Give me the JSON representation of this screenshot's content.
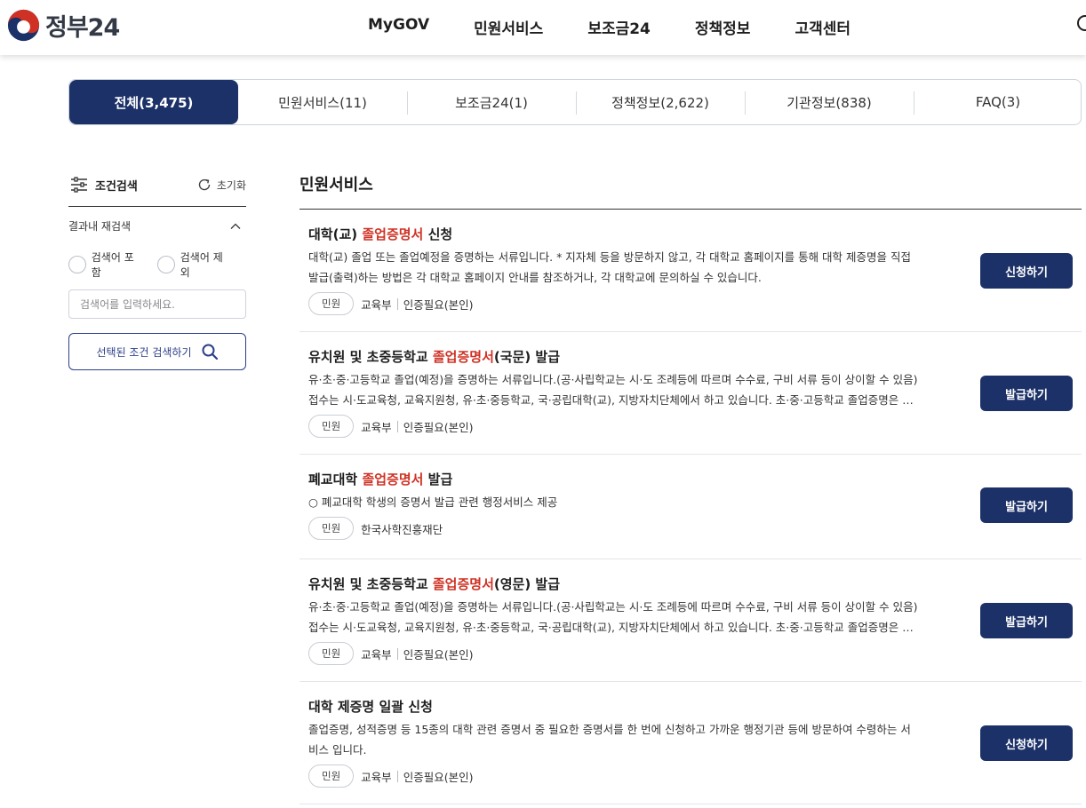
{
  "header": {
    "logo_text": "정부24",
    "nav": [
      "MyGOV",
      "민원서비스",
      "보조금24",
      "정책정보",
      "고객센터"
    ]
  },
  "tabs": [
    {
      "label": "전체(3,475)",
      "active": true
    },
    {
      "label": "민원서비스(11)",
      "active": false
    },
    {
      "label": "보조금24(1)",
      "active": false
    },
    {
      "label": "정책정보(2,622)",
      "active": false
    },
    {
      "label": "기관정보(838)",
      "active": false
    },
    {
      "label": "FAQ(3)",
      "active": false
    }
  ],
  "sidebar": {
    "title": "조건검색",
    "reset_label": "초기화",
    "refine_label": "결과내 재검색",
    "radio_include": "검색어 포함",
    "radio_exclude": "검색어 제외",
    "input_placeholder": "검색어를 입력하세요.",
    "search_button": "선택된 조건 검색하기"
  },
  "results": {
    "section_title": "민원서비스",
    "items": [
      {
        "title_pre": "대학(교) ",
        "title_hl": "졸업증명서",
        "title_post": " 신청",
        "desc": [
          "대학(교) 졸업 또는 졸업예정을 증명하는 서류입니다. * 지자체 등을 방문하지 않고, 각 대학교 홈페이지를 통해 대학 제증명을 직접",
          "발급(출력)하는 방법은 각 대학교 홈페이지 안내를 참조하거나, 각 대학교에 문의하실 수 있습니다."
        ],
        "badge": "민원",
        "agency": "교육부",
        "auth": "인증필요(본인)",
        "action": "신청하기"
      },
      {
        "title_pre": "유치원 및 초중등학교 ",
        "title_hl": "졸업증명서",
        "title_post": "(국문) 발급",
        "desc": [
          "유·초·중·고등학교 졸업(예정)을 증명하는 서류입니다.(공·사립학교는 시·도 조례등에 따르며 수수료, 구비 서류 등이 상이할 수 있음)",
          "접수는 시·도교육청, 교육지원청, 유·초·중등학교, 국·공립대학(교), 지방자치단체에서 하고 있습니다. 초·중·고등학교 졸업증명은 …"
        ],
        "badge": "민원",
        "agency": "교육부",
        "auth": "인증필요(본인)",
        "action": "발급하기"
      },
      {
        "title_pre": "폐교대학 ",
        "title_hl": "졸업증명서",
        "title_post": " 발급",
        "desc": [
          "○ 폐교대학 학생의 증명서 발급 관련 행정서비스 제공"
        ],
        "badge": "민원",
        "agency": "한국사학진흥재단",
        "auth": "",
        "action": "발급하기"
      },
      {
        "title_pre": "유치원 및 초중등학교 ",
        "title_hl": "졸업증명서",
        "title_post": "(영문) 발급",
        "desc": [
          "유·초·중·고등학교 졸업(예정)을 증명하는 서류입니다.(공·사립학교는 시·도 조례등에 따르며 수수료, 구비 서류 등이 상이할 수 있음)",
          "접수는 시·도교육청, 교육지원청, 유·초·중등학교, 국·공립대학(교), 지방자치단체에서 하고 있습니다. 초·중·고등학교 졸업증명은 …"
        ],
        "badge": "민원",
        "agency": "교육부",
        "auth": "인증필요(본인)",
        "action": "발급하기"
      },
      {
        "title_pre": "대학 제증명 일괄 신청",
        "title_hl": "",
        "title_post": "",
        "desc": [
          "졸업증명, 성적증명 등 15종의 대학 관련 증명서 중 필요한 증명서를 한 번에 신청하고 가까운 행정기관 등에 방문하여 수령하는 서",
          "비스 입니다."
        ],
        "badge": "민원",
        "agency": "교육부",
        "auth": "인증필요(본인)",
        "action": "신청하기"
      }
    ]
  },
  "colors": {
    "primary": "#1c3168",
    "highlight": "#cf3224",
    "outline_blue": "#2c3f8a"
  }
}
